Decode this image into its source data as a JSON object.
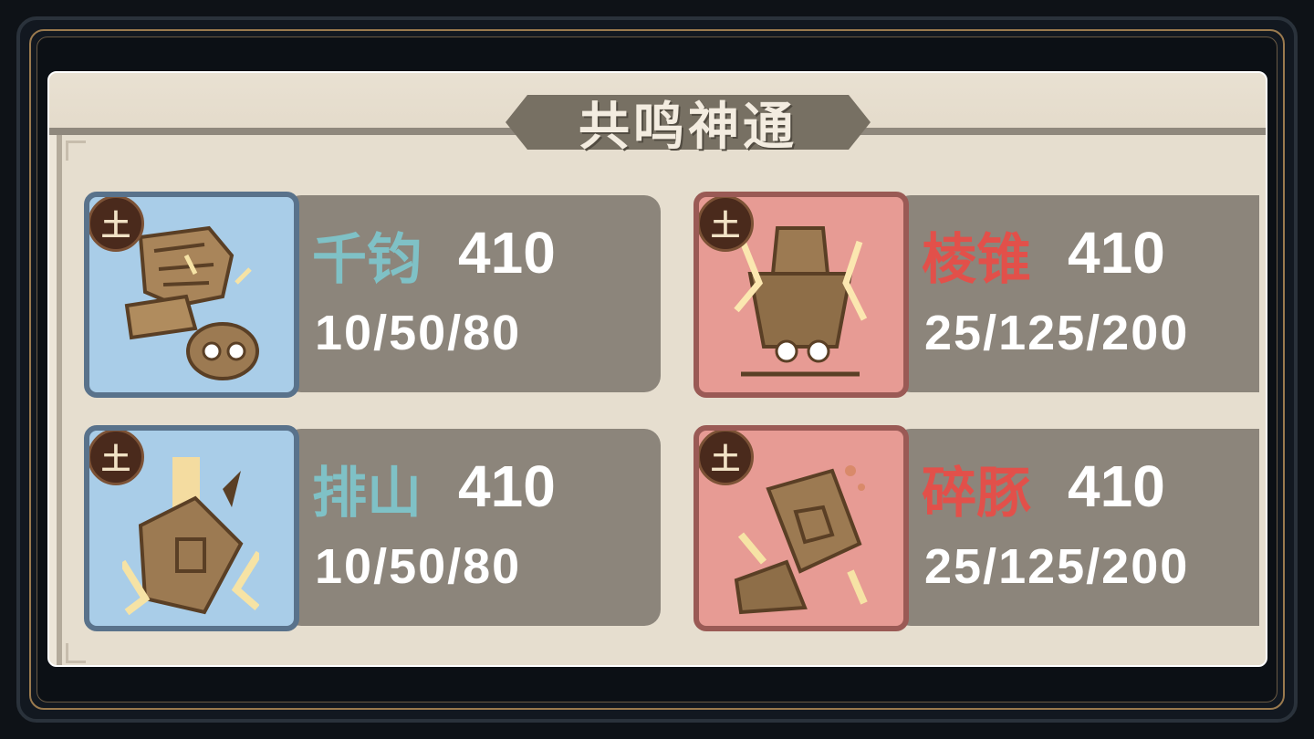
{
  "panel": {
    "title": "共鸣神通"
  },
  "cards": [
    {
      "element": "土",
      "name": "千钧",
      "value": "410",
      "stats": "10/50/80",
      "icon": "fist-rock-icon",
      "theme": "blue"
    },
    {
      "element": "土",
      "name": "棱锥",
      "value": "410",
      "stats": "25/125/200",
      "icon": "stone-spike-icon",
      "theme": "red"
    },
    {
      "element": "土",
      "name": "排山",
      "value": "410",
      "stats": "10/50/80",
      "icon": "rock-burst-icon",
      "theme": "blue"
    },
    {
      "element": "土",
      "name": "碎豚",
      "value": "410",
      "stats": "25/125/200",
      "icon": "stone-shatter-icon",
      "theme": "red"
    }
  ],
  "colors": {
    "blue_name": "#7fc1c6",
    "red_name": "#e2504a",
    "blue_frame": "#a9cde8",
    "red_frame": "#e79b94",
    "stat_bg": "#8c857b"
  }
}
